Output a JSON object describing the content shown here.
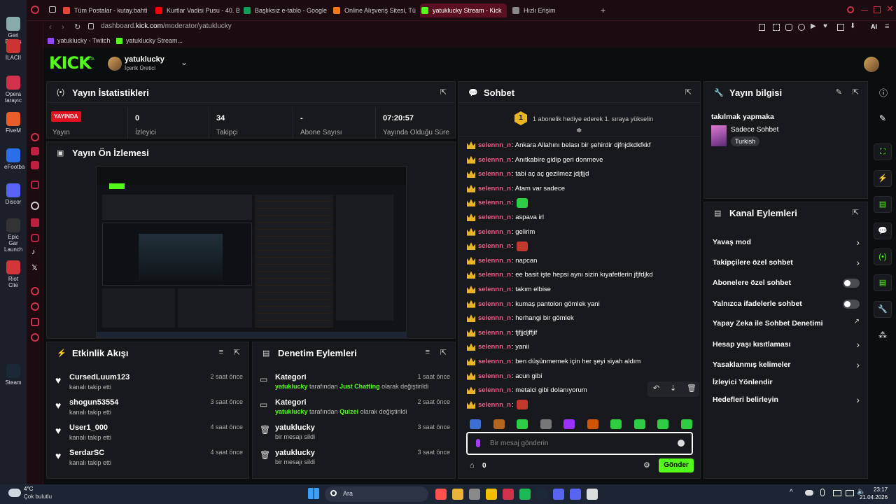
{
  "desktop": {
    "icons": [
      {
        "label": "Geri Dönüş",
        "color": "#8aa"
      },
      {
        "label": "İLACII",
        "color": "#c33"
      },
      {
        "label": "Opera tarayıc",
        "color": "#d0314b"
      },
      {
        "label": "FiveM",
        "color": "#e85d2a"
      },
      {
        "label": "eFootba",
        "color": "#2a6fe8"
      },
      {
        "label": "Discor",
        "color": "#5865f2"
      },
      {
        "label": "Epic Gar Launch",
        "color": "#333"
      },
      {
        "label": "Riot Clie",
        "color": "#d13639"
      },
      {
        "label": "Steam",
        "color": "#1b2838"
      }
    ]
  },
  "browser": {
    "tabs": [
      {
        "label": "Tüm Postalar - kutay.bahti",
        "color": "#ea4335"
      },
      {
        "label": "Kurtlar Vadisi Pusu - 40. B",
        "color": "#ff0000"
      },
      {
        "label": "Başlıksız e-tablo - Google",
        "color": "#0f9d58"
      },
      {
        "label": "Online Alışveriş Sitesi, Tü",
        "color": "#f27a1a"
      },
      {
        "label": "yatuklucky Stream - Kick",
        "color": "#53fc18"
      },
      {
        "label": "Hızlı Erişim",
        "color": "#888"
      }
    ],
    "new_tab": "+",
    "url_prefix": "dashboard.",
    "url_domain": "kick.com",
    "url_path": "/moderator/yatuklucky",
    "bookmarks": [
      {
        "label": "yatuklucky - Twitch",
        "color": "#9146ff"
      },
      {
        "label": "yatuklucky Stream...",
        "color": "#53fc18"
      }
    ],
    "ai_label": "AI"
  },
  "kick": {
    "logo": "KICK",
    "beta": "BETA",
    "user": {
      "name": "yatuklucky",
      "role": "İçerik Üretici"
    }
  },
  "stats": {
    "title": "Yayın İstatistikleri",
    "live_badge": "YAYINDA",
    "live_label": "Yayın",
    "items": [
      {
        "value": "0",
        "label": "İzleyici"
      },
      {
        "value": "34",
        "label": "Takipçi"
      },
      {
        "value": "-",
        "label": "Abone Sayısı"
      },
      {
        "value": "07:20:57",
        "label": "Yayında Olduğu Süre"
      }
    ]
  },
  "preview": {
    "title": "Yayın Ön İzlemesi"
  },
  "feed": {
    "title": "Etkinlik Akışı",
    "items": [
      {
        "name": "CursedLuum123",
        "sub": "kanalı takip etti",
        "time": "2 saat önce"
      },
      {
        "name": "shogun53554",
        "sub": "kanalı takip etti",
        "time": "3 saat önce"
      },
      {
        "name": "User1_000",
        "sub": "kanalı takip etti",
        "time": "4 saat önce"
      },
      {
        "name": "SerdarSC",
        "sub": "kanalı takip etti",
        "time": "4 saat önce"
      }
    ]
  },
  "mod": {
    "title": "Denetim Eylemleri",
    "items": [
      {
        "name": "Kategori",
        "user": "yatuklucky",
        "mid": " tarafından ",
        "cat": "Just Chatting",
        "tail": " olarak değiştirildi",
        "time": "1 saat önce"
      },
      {
        "name": "Kategori",
        "user": "yatuklucky",
        "mid": " tarafından ",
        "cat": "Quizei",
        "tail": " olarak değiştirildi",
        "time": "2 saat önce"
      },
      {
        "name": "yatuklucky",
        "user": "",
        "mid": "bir mesajı sildi",
        "cat": "",
        "tail": "",
        "time": "3 saat önce"
      },
      {
        "name": "yatuklucky",
        "user": "",
        "mid": "bir mesajı sildi",
        "cat": "",
        "tail": "",
        "time": "3 saat önce"
      }
    ]
  },
  "chat": {
    "title": "Sohbet",
    "sub_rank": "1",
    "sub_text": "1 abonelik hediye ederek 1. sıraya yükselin",
    "messages": [
      {
        "user": "selennn_n",
        "text": ": Ankara Allahını belası bir şehirdir djfnjdkdkfkkf"
      },
      {
        "user": "selennn_n",
        "text": ": Anıtkabire gidip geri donmeve"
      },
      {
        "user": "selennn_n",
        "text": ": tabi aç aç gezilmez jdjfjjd"
      },
      {
        "user": "selennn_n",
        "text": ": Atam var sadece"
      },
      {
        "user": "selennn_n",
        "text": ":",
        "emote": "#2ecc40"
      },
      {
        "user": "selennn_n",
        "text": ": aspava irl"
      },
      {
        "user": "selennn_n",
        "text": ": gelirim"
      },
      {
        "user": "selennn_n",
        "text": ":",
        "emote": "#c0392b"
      },
      {
        "user": "selennn_n",
        "text": ": napcan"
      },
      {
        "user": "selennn_n",
        "text": ": ee basit işte hepsi aynı sizin kıyafetlerin jfjfdjkd"
      },
      {
        "user": "selennn_n",
        "text": ": takım elbise"
      },
      {
        "user": "selennn_n",
        "text": ": kumaş pantolon gömlek yani"
      },
      {
        "user": "selennn_n",
        "text": ": herhangi bir gömlek"
      },
      {
        "user": "selennn_n",
        "text": ": fjfjjdjffjif"
      },
      {
        "user": "selennn_n",
        "text": ": yanii"
      },
      {
        "user": "selennn_n",
        "text": ": ben düşünmemek için her şeyi siyah aldım"
      },
      {
        "user": "selennn_n",
        "text": ": acun gibi"
      },
      {
        "user": "selennn_n",
        "text": ": metalci gibi dolanıyorum"
      },
      {
        "user": "selennn_n",
        "text": ":",
        "emote": "#c0392b"
      }
    ],
    "emote_colors": [
      "#3b6fd6",
      "#b5651d",
      "#2ecc40",
      "#777",
      "#9b30ff",
      "#d35400",
      "#2ecc40",
      "#2ecc40",
      "#2ecc40",
      "#2ecc40"
    ],
    "input_placeholder": "Bir mesaj gönderin",
    "count": "0",
    "send": "Gönder"
  },
  "info": {
    "title": "Yayın bilgisi",
    "stream_title": "takılmak yapmaka",
    "category": "Sadece Sohbet",
    "tag": "Turkish"
  },
  "actions": {
    "title": "Kanal Eylemleri",
    "items": [
      {
        "label": "Yavaş mod",
        "kind": "chevron"
      },
      {
        "label": "Takipçilere özel sohbet",
        "kind": "chevron"
      },
      {
        "label": "Abonelere özel sohbet",
        "kind": "toggle"
      },
      {
        "label": "Yalnızca ifadelerle sohbet",
        "kind": "toggle"
      },
      {
        "label": "Yapay Zeka ile Sohbet Denetimi",
        "kind": "ext"
      },
      {
        "label": "Hesap yaşı kısıtlaması",
        "kind": "chevron"
      },
      {
        "label": "Yasaklanmış kelimeler",
        "kind": "chevron"
      },
      {
        "label": "İzleyici Yönlendir",
        "kind": "none"
      },
      {
        "label": "Hedefleri belirleyin",
        "kind": "chevron"
      }
    ]
  },
  "taskbar": {
    "weather_temp": "4°C",
    "weather_text": "Çok bulutlu",
    "search": "Ara",
    "time": "23:17",
    "date": "21.04.2026",
    "apps": [
      "#ff5050",
      "#e8b43a",
      "#8a8a8a",
      "#f0c000",
      "#d0314b",
      "#1db954",
      "#1b2838",
      "#5865f2",
      "#5865f2",
      "#ddd"
    ]
  }
}
